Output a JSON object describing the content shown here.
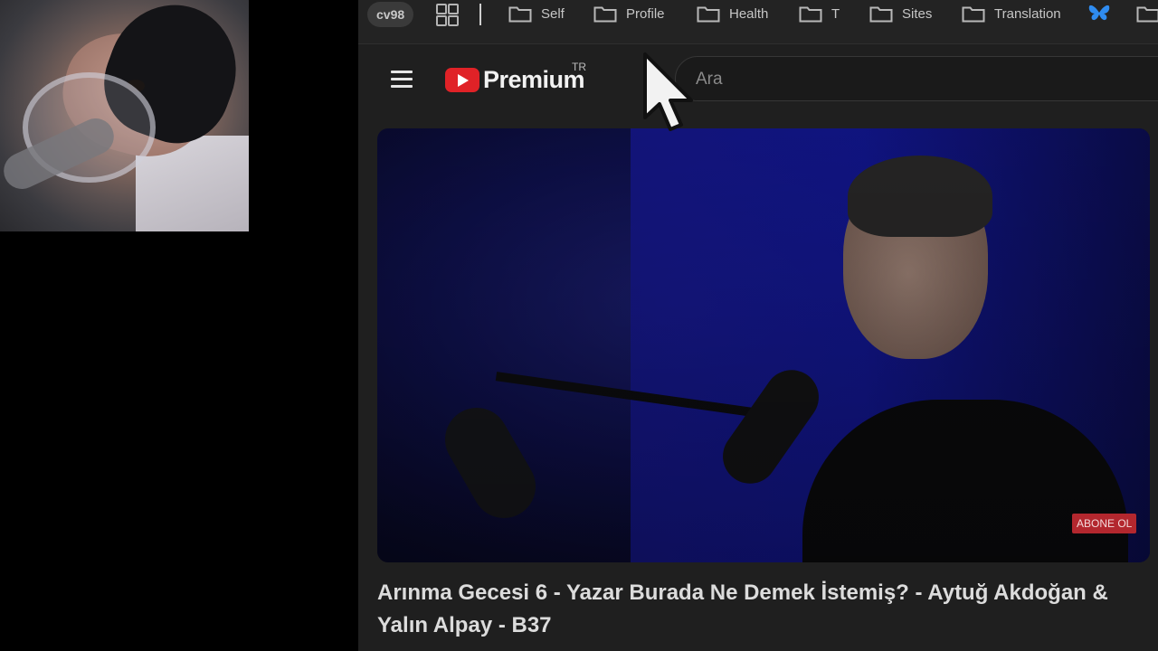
{
  "webcam": {
    "description_icon": "webcam-feed"
  },
  "bookmarks_bar": {
    "profile": "cv98",
    "apps_icon": "apps-grid-icon",
    "items": [
      {
        "label": "Self",
        "icon": "folder-icon"
      },
      {
        "label": "Profile",
        "icon": "folder-icon"
      },
      {
        "label": "Health",
        "icon": "folder-icon"
      },
      {
        "label": "T",
        "icon": "folder-icon"
      },
      {
        "label": "Sites",
        "icon": "folder-icon"
      },
      {
        "label": "Translation",
        "icon": "folder-icon"
      }
    ],
    "extra_icons": [
      "butterfly-icon",
      "folder-icon"
    ]
  },
  "header": {
    "menu_icon": "hamburger-menu-icon",
    "logo_text": "Premium",
    "country": "TR",
    "search_placeholder": "Ara"
  },
  "video": {
    "badge": "ABONE OL",
    "title": "Arınma Gecesi 6 - Yazar Burada Ne Demek İstemiş? - Aytuğ Akdoğan & Yalın Alpay - B37"
  },
  "colors": {
    "background": "#1f1f1f",
    "youtube_red": "#e02227",
    "badge_red": "#b3272e"
  }
}
